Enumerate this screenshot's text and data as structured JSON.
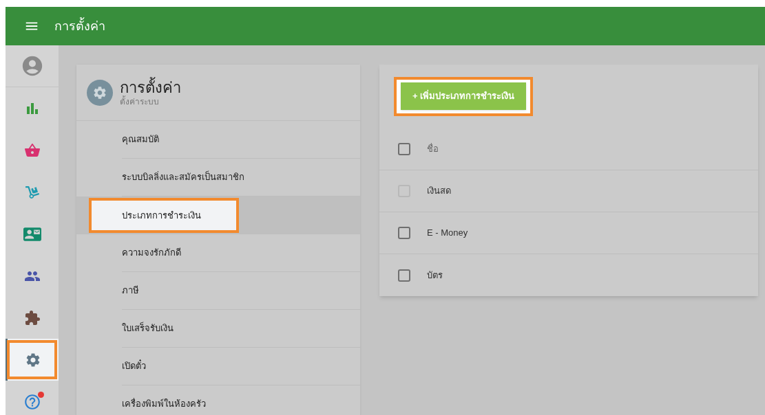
{
  "app_bar": {
    "title": "การตั้งค่า"
  },
  "rail": [
    {
      "kind": "account",
      "selected": false,
      "highlighted": false
    },
    {
      "kind": "chart",
      "selected": false,
      "highlighted": false
    },
    {
      "kind": "basket",
      "selected": false,
      "highlighted": false
    },
    {
      "kind": "dolly",
      "selected": false,
      "highlighted": false
    },
    {
      "kind": "card",
      "selected": false,
      "highlighted": false
    },
    {
      "kind": "people",
      "selected": false,
      "highlighted": false
    },
    {
      "kind": "puzzle",
      "selected": false,
      "highlighted": false
    },
    {
      "kind": "settings",
      "selected": true,
      "highlighted": true
    },
    {
      "kind": "help",
      "selected": false,
      "highlighted": false,
      "notification": true
    }
  ],
  "settings_card": {
    "title": "การตั้งค่า",
    "subtitle": "ตั้งค่าระบบ",
    "items": [
      {
        "label": "คุณสมบัติ",
        "selected": false,
        "highlighted": false
      },
      {
        "label": "ระบบบิลลิ่งและสมัครเป็นสมาชิก",
        "selected": false,
        "highlighted": false
      },
      {
        "label": "ประเภทการชำระเงิน",
        "selected": true,
        "highlighted": true
      },
      {
        "label": "ความจงรักภักดี",
        "selected": false,
        "highlighted": false
      },
      {
        "label": "ภาษี",
        "selected": false,
        "highlighted": false
      },
      {
        "label": "ใบเสร็จรับเงิน",
        "selected": false,
        "highlighted": false
      },
      {
        "label": "เปิดตั๋ว",
        "selected": false,
        "highlighted": false
      },
      {
        "label": "เครื่องพิมพ์ในห้องครัว",
        "selected": false,
        "highlighted": false
      }
    ]
  },
  "payment_types": {
    "add_button": {
      "label": "+ เพิ่มประเภทการชำระเงิน",
      "highlighted": true
    },
    "header": {
      "label": "ชื่อ",
      "checked": false
    },
    "rows": [
      {
        "name": "เงินสด",
        "checked": false,
        "disabled": true
      },
      {
        "name": "E - Money",
        "checked": false,
        "disabled": false
      },
      {
        "name": "บัตร",
        "checked": false,
        "disabled": false
      }
    ]
  }
}
